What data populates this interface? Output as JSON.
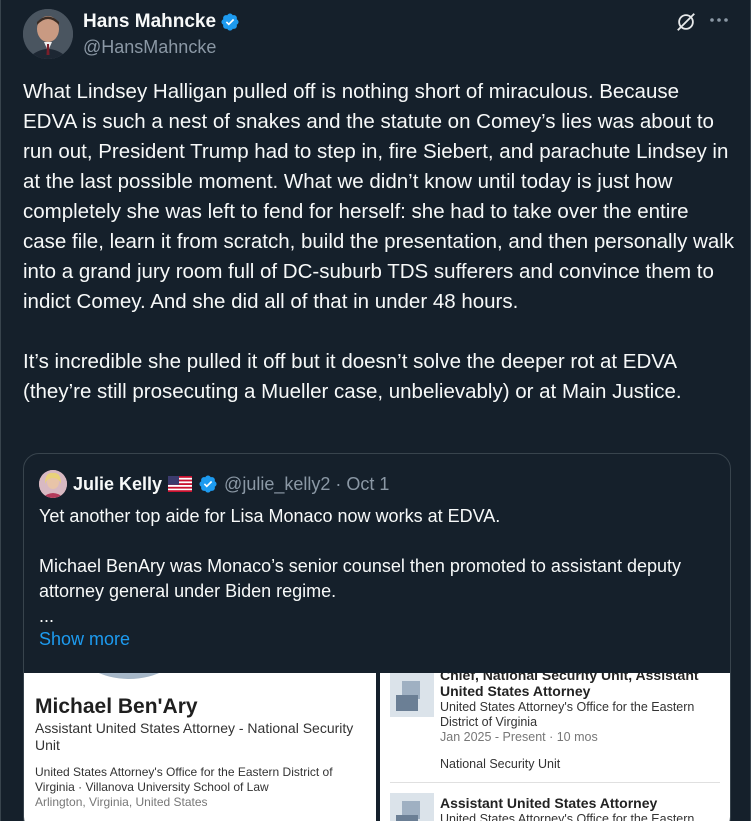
{
  "author": {
    "name": "Hans Mahncke",
    "handle": "@HansMahncke"
  },
  "tweet": {
    "body": "What Lindsey Halligan pulled off is nothing short of miraculous. Because EDVA is such a nest of snakes and the statute on Comey’s lies was about to run out, President Trump had to step in, fire Siebert, and parachute Lindsey in at the last possible moment. What we didn’t know until today is just how completely she was left to fend for herself: she had to take over the entire case file, learn it from scratch, build the presentation, and then personally walk into a grand jury room full of DC-suburb TDS sufferers and convince them to indict Comey. And she did all of that in under 48 hours.\n\nIt’s incredible she pulled it off but it doesn’t solve the deeper rot at EDVA (they’re still prosecuting a Mueller case, unbelievably) or at Main Justice."
  },
  "quote": {
    "name": "Julie Kelly",
    "handle_date": "@julie_kelly2 · Oct 1",
    "text": "Yet another top aide for Lisa Monaco now works at EDVA.\n\nMichael BenAry was Monaco’s senior counsel then promoted to assistant deputy attorney general under Biden regime.\n...",
    "show_more": "Show more"
  },
  "profile_card": {
    "name": "Michael Ben'Ary",
    "title": "Assistant United States Attorney - National Security Unit",
    "org": "United States Attorney's Office for the Eastern District of Virginia · Villanova University School of Law",
    "location": "Arlington, Virginia, United States"
  },
  "experience": {
    "partial_title": "Chief, National Security Unit, Assistant",
    "title1": "United States Attorney",
    "org1": "United States Attorney's Office for the Eastern District of Virginia",
    "date1": "Jan 2025 - Present · 10 mos",
    "unit1": "National Security Unit",
    "title2": "Assistant United States Attorney",
    "org2": "United States Attorney's Office for the Eastern"
  },
  "colors": {
    "background": "#15202b",
    "text": "#f7f9f9",
    "muted": "#8b98a5",
    "accent": "#1d9bf0"
  },
  "icons": [
    "verified-badge-icon",
    "grok-icon",
    "more-icon",
    "us-flag-icon"
  ]
}
